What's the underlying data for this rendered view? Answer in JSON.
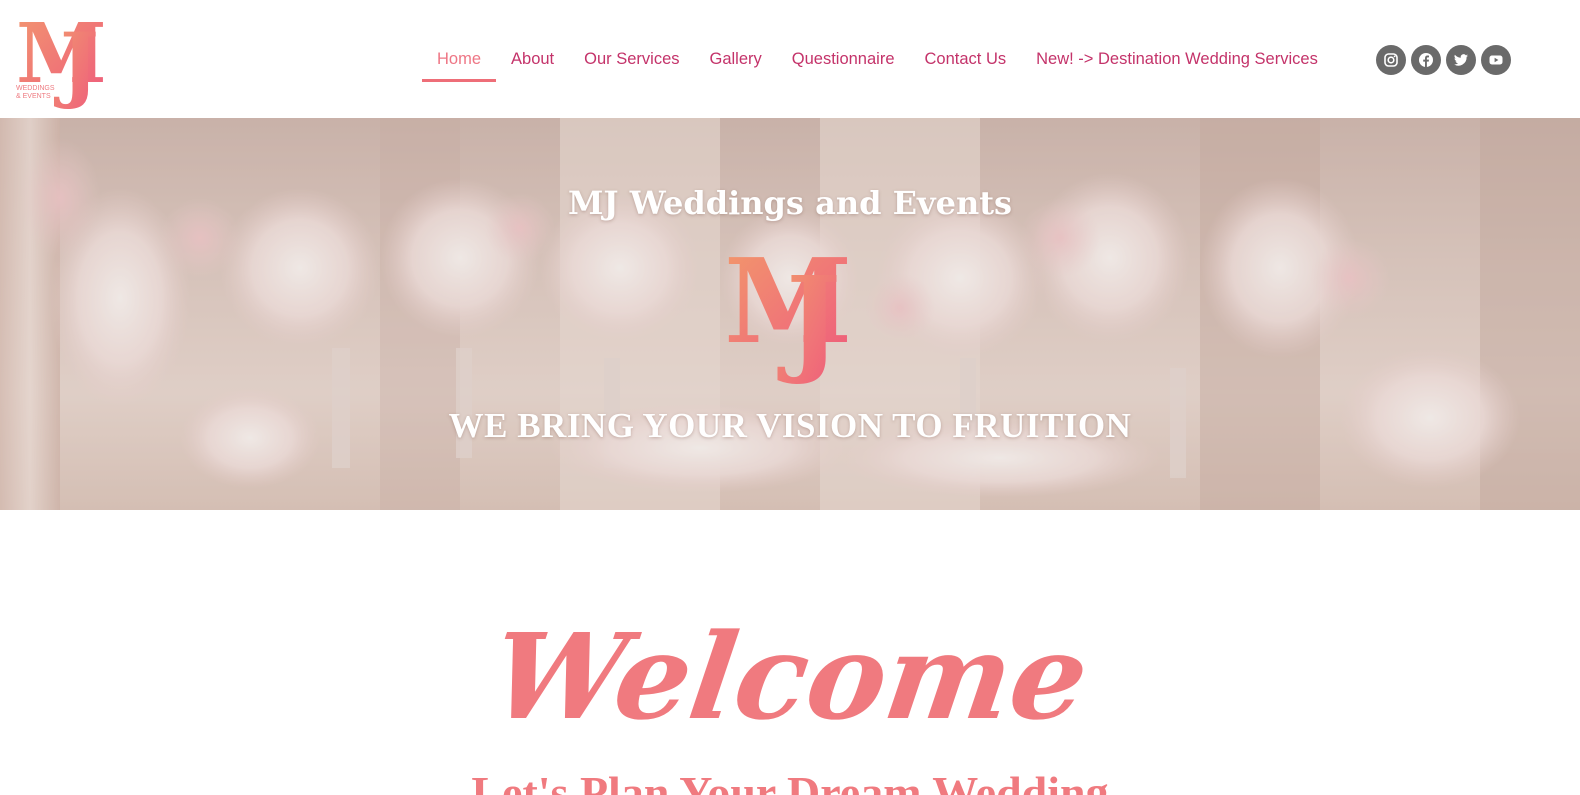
{
  "brand": {
    "logo_text": "MJ",
    "logo_subtext": "WEDDINGS & EVENTS",
    "accent_color": "#f07a7f",
    "nav_color": "#c4336a"
  },
  "nav": {
    "items": [
      {
        "label": "Home",
        "active": true
      },
      {
        "label": "About"
      },
      {
        "label": "Our Services"
      },
      {
        "label": "Gallery"
      },
      {
        "label": "Questionnaire"
      },
      {
        "label": "Contact Us"
      },
      {
        "label": "New! -> Destination Wedding Services"
      }
    ]
  },
  "social": [
    {
      "icon": "instagram-icon"
    },
    {
      "icon": "facebook-icon"
    },
    {
      "icon": "twitter-icon"
    },
    {
      "icon": "youtube-icon"
    }
  ],
  "hero": {
    "title": "MJ Weddings and Events",
    "tagline": "WE BRING YOUR VISION TO FRUITION"
  },
  "welcome": {
    "heading": "Welcome",
    "subheading": "Let's Plan Your Dream Wedding"
  }
}
